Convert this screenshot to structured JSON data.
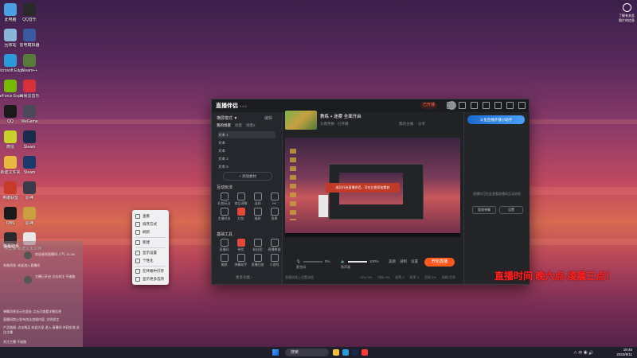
{
  "desktop": {
    "icons": [
      {
        "label": "此电脑",
        "color": "#4aa0e0"
      },
      {
        "label": "QQ音乐",
        "color": "#2a2a2a"
      },
      {
        "label": "回收站",
        "color": "#8ab4d8"
      },
      {
        "label": "雷电模拟器",
        "color": "#3a5aa0"
      },
      {
        "label": "Microsoft Edge",
        "color": "#2a9ad8"
      },
      {
        "label": "Steam++",
        "color": "#5a7a3a"
      },
      {
        "label": "GeForce Experience",
        "color": "#76b900"
      },
      {
        "label": "网易云音乐",
        "color": "#d8303a"
      },
      {
        "label": "QQ",
        "color": "#1a1a1a"
      },
      {
        "label": "WeGame",
        "color": "#4a4a5a"
      },
      {
        "label": "微信",
        "color": "#c8d02a"
      },
      {
        "label": "Steam",
        "color": "#1a2a4a"
      },
      {
        "label": "新建文件夹",
        "color": "#e8b840"
      },
      {
        "label": "Steam",
        "color": "#1a3a6a"
      },
      {
        "label": "英雄联盟",
        "color": "#c83a2a"
      },
      {
        "label": "原神",
        "color": "#3a3a4a"
      },
      {
        "label": "OBS",
        "color": "#1a1a1a"
      },
      {
        "label": "原神",
        "color": "#c8a040"
      },
      {
        "label": "快剪辑",
        "color": "#2a2a2a"
      },
      {
        "label": "新建文本文档",
        "color": "#e8e8e8"
      }
    ],
    "top_right": "了解有关此图片的信息"
  },
  "app": {
    "name": "直播伴侣",
    "version": "6.8.0",
    "live_pill": "已开播",
    "scene_mode": "横屏模式 ▼",
    "edit_label": "编辑",
    "scene_tabs": [
      "我的场景",
      "场景",
      "场景2"
    ],
    "sources": [
      "文本 1",
      "文本",
      "文本",
      "文本 2",
      "文本 5"
    ],
    "add_source": "+ 添加素材",
    "tools_title": "互动玩法",
    "tools": [
      {
        "label": "礼物玩法"
      },
      {
        "label": "商品讲解"
      },
      {
        "label": "连线"
      },
      {
        "label": "PK"
      },
      {
        "label": "主播任务"
      },
      {
        "label": "红包"
      },
      {
        "label": "福袋"
      },
      {
        "label": "投票"
      }
    ],
    "basic_title": "基础工具",
    "basic_tools": [
      {
        "label": "直播间"
      },
      {
        "label": "带货"
      },
      {
        "label": "粉丝团"
      },
      {
        "label": "直播数据"
      },
      {
        "label": "美颜"
      },
      {
        "label": "弹幕助手"
      },
      {
        "label": "直播回放"
      },
      {
        "label": "小游戏"
      }
    ],
    "more": "更多功能 ›",
    "stream_title": "教练 + 迷雾 全面开启",
    "stream_meta": "头像更换 · 已开播",
    "meta_right": [
      "我的主播",
      "分享"
    ],
    "preview_popup": "成功开启直播伴侣，可在左侧添加素材",
    "mic_label": "麦克风",
    "mic_value": "0%",
    "speaker_label": "扬声器",
    "speaker_value": "100%",
    "ctrl_labels": [
      "美颜",
      "录制",
      "设置"
    ],
    "go_live": "开始直播",
    "status_left": "直播间线上设置流程",
    "status_right": [
      "CPU 0%",
      "内存 0%",
      "帧率 0",
      "码率 0",
      "丢帧 0%",
      "网络 优秀"
    ],
    "banner": "斗鱼直播开播小助手",
    "rp_text": "直播时可在此查看直播间互动消息",
    "rp_btn1": "管理弹幕",
    "rp_btn2": "设置",
    "mic_level": 0,
    "speaker_level": 1.0
  },
  "context_menu": {
    "items": [
      "查看",
      "排序方式",
      "刷新",
      "新建",
      "显示设置",
      "个性化",
      "在终端中打开",
      "显示更多选项"
    ]
  },
  "chat": {
    "title": "弹幕助手",
    "lines": [
      "欢迎来到直播间 人气: 21.2w",
      "系统消息: 欢迎进入直播间",
      "主播已开启 点击关注 不迷路",
      "弹幕消息显示在此处 点击可查看详细信息",
      "直播间禁止发布违法违规内容, 文明发言",
      "产品链接: 点击购买 欢迎大家 进入 直播间 共同交流 关注主播",
      "关注主播 不迷路"
    ]
  },
  "overlay_text": "直播时间 晚六点-凌晨三点！",
  "taskbar": {
    "search": "搜索",
    "time": "19:45",
    "date": "2023/8/11",
    "tray": "∧  中  ◉ 🔊"
  }
}
